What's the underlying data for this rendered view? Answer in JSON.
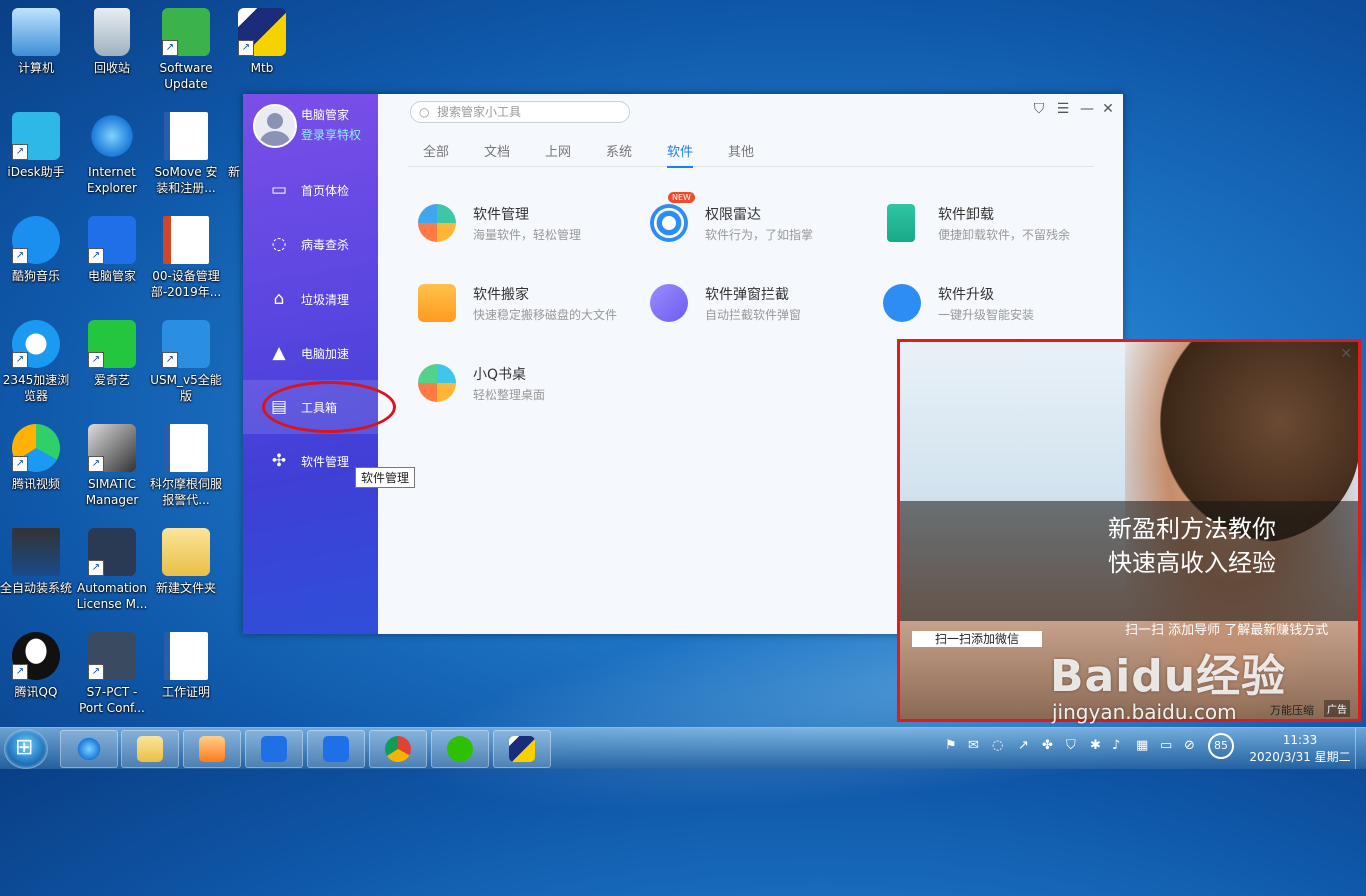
{
  "desktop": {
    "icons": [
      {
        "label": "计算机"
      },
      {
        "label": "回收站"
      },
      {
        "label": "Software Update"
      },
      {
        "label": "Mtb"
      },
      {
        "label": "iDesk助手"
      },
      {
        "label": "Internet Explorer"
      },
      {
        "label": "SoMove 安装和注册..."
      },
      {
        "label": "新"
      },
      {
        "label": "酷狗音乐"
      },
      {
        "label": "电脑管家"
      },
      {
        "label": "00-设备管理部-2019年..."
      },
      {
        "label": "2345加速浏览器"
      },
      {
        "label": "爱奇艺"
      },
      {
        "label": "USM_v5全能版"
      },
      {
        "label": "腾讯视频"
      },
      {
        "label": "SIMATIC Manager"
      },
      {
        "label": "科尔摩根伺服报警代..."
      },
      {
        "label": "全自动装系统"
      },
      {
        "label": "Automation License M..."
      },
      {
        "label": "新建文件夹"
      },
      {
        "label": "腾讯QQ"
      },
      {
        "label": "S7-PCT - Port Conf..."
      },
      {
        "label": "工作证明"
      }
    ]
  },
  "app": {
    "profile": {
      "name": "电脑管家",
      "privilege": "登录享特权"
    },
    "nav": [
      {
        "label": "首页体检",
        "icon": "monitor-icon"
      },
      {
        "label": "病毒查杀",
        "icon": "virus-icon"
      },
      {
        "label": "垃圾清理",
        "icon": "broom-icon"
      },
      {
        "label": "电脑加速",
        "icon": "rocket-icon"
      },
      {
        "label": "工具箱",
        "icon": "toolbox-icon"
      },
      {
        "label": "软件管理",
        "icon": "software-icon"
      }
    ],
    "search": {
      "placeholder": "搜索管家小工具"
    },
    "tabs": [
      "全部",
      "文档",
      "上网",
      "系统",
      "软件",
      "其他"
    ],
    "active_tab": "软件",
    "tools": [
      {
        "name": "软件管理",
        "desc": "海量软件，轻松管理"
      },
      {
        "name": "权限雷达",
        "desc": "软件行为，了如指掌",
        "badge": "NEW"
      },
      {
        "name": "软件卸载",
        "desc": "便捷卸载软件，不留残余"
      },
      {
        "name": "软件搬家",
        "desc": "快速稳定搬移磁盘的大文件"
      },
      {
        "name": "软件弹窗拦截",
        "desc": "自动拦截软件弹窗"
      },
      {
        "name": "软件升级",
        "desc": "一键升级智能安装"
      },
      {
        "name": "小Q书桌",
        "desc": "轻松整理桌面"
      }
    ],
    "tooltip": "软件管理"
  },
  "ad": {
    "headline_line1": "新盈利方法教你",
    "headline_line2": "快速高收入经验",
    "sub": "扫一扫 添加导师 了解最新赚钱方式",
    "button": "扫一扫添加微信",
    "brand": "万能压缩",
    "tag": "广告"
  },
  "watermark": {
    "main": "Baidu经验",
    "sub": "jingyan.baidu.com"
  },
  "taskbar": {
    "battery": "85",
    "time": "11:33",
    "date": "2020/3/31 星期二"
  },
  "colors": {
    "accent": "#1f7ef0",
    "sidebar": "#5a46e0",
    "annotation": "#d9141f"
  }
}
